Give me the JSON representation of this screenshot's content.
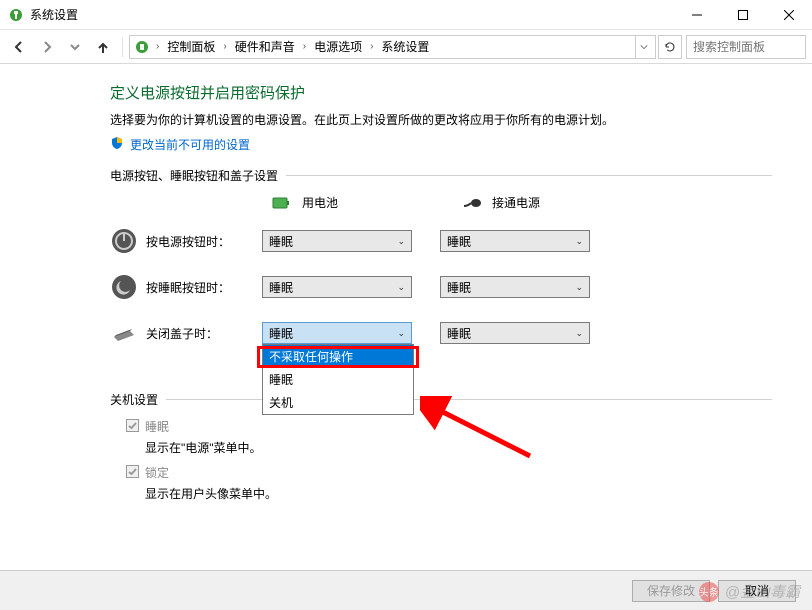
{
  "titlebar": {
    "title": "系统设置"
  },
  "breadcrumb": {
    "items": [
      "控制面板",
      "硬件和声音",
      "电源选项",
      "系统设置"
    ],
    "search_placeholder": "搜索控制面板"
  },
  "content": {
    "title": "定义电源按钮并启用密码保护",
    "desc": "选择要为你的计算机设置的电源设置。在此页上对设置所做的更改将应用于你所有的电源计划。",
    "admin_link": "更改当前不可用的设置",
    "section1_title": "电源按钮、睡眠按钮和盖子设置",
    "cols": {
      "battery": "用电池",
      "plugged": "接通电源"
    },
    "rows": [
      {
        "label": "按电源按钮时：",
        "battery": "睡眠",
        "plugged": "睡眠"
      },
      {
        "label": "按睡眠按钮时：",
        "battery": "睡眠",
        "plugged": "睡眠"
      },
      {
        "label": "关闭盖子时：",
        "battery": "睡眠",
        "plugged": "睡眠"
      }
    ],
    "dropdown_open": {
      "items": [
        "不采取任何操作",
        "睡眠",
        "关机"
      ],
      "hover_index": 0
    },
    "section2_title": "关机设置",
    "shutdown_items": [
      {
        "label": "睡眠",
        "desc": "显示在\"电源\"菜单中。",
        "checked": true
      },
      {
        "label": "锁定",
        "desc": "显示在用户头像菜单中。",
        "checked": true
      }
    ]
  },
  "footer": {
    "save": "保存修改",
    "cancel": "取消"
  },
  "watermark": {
    "label": "头条",
    "text": "@金山毒霸"
  }
}
